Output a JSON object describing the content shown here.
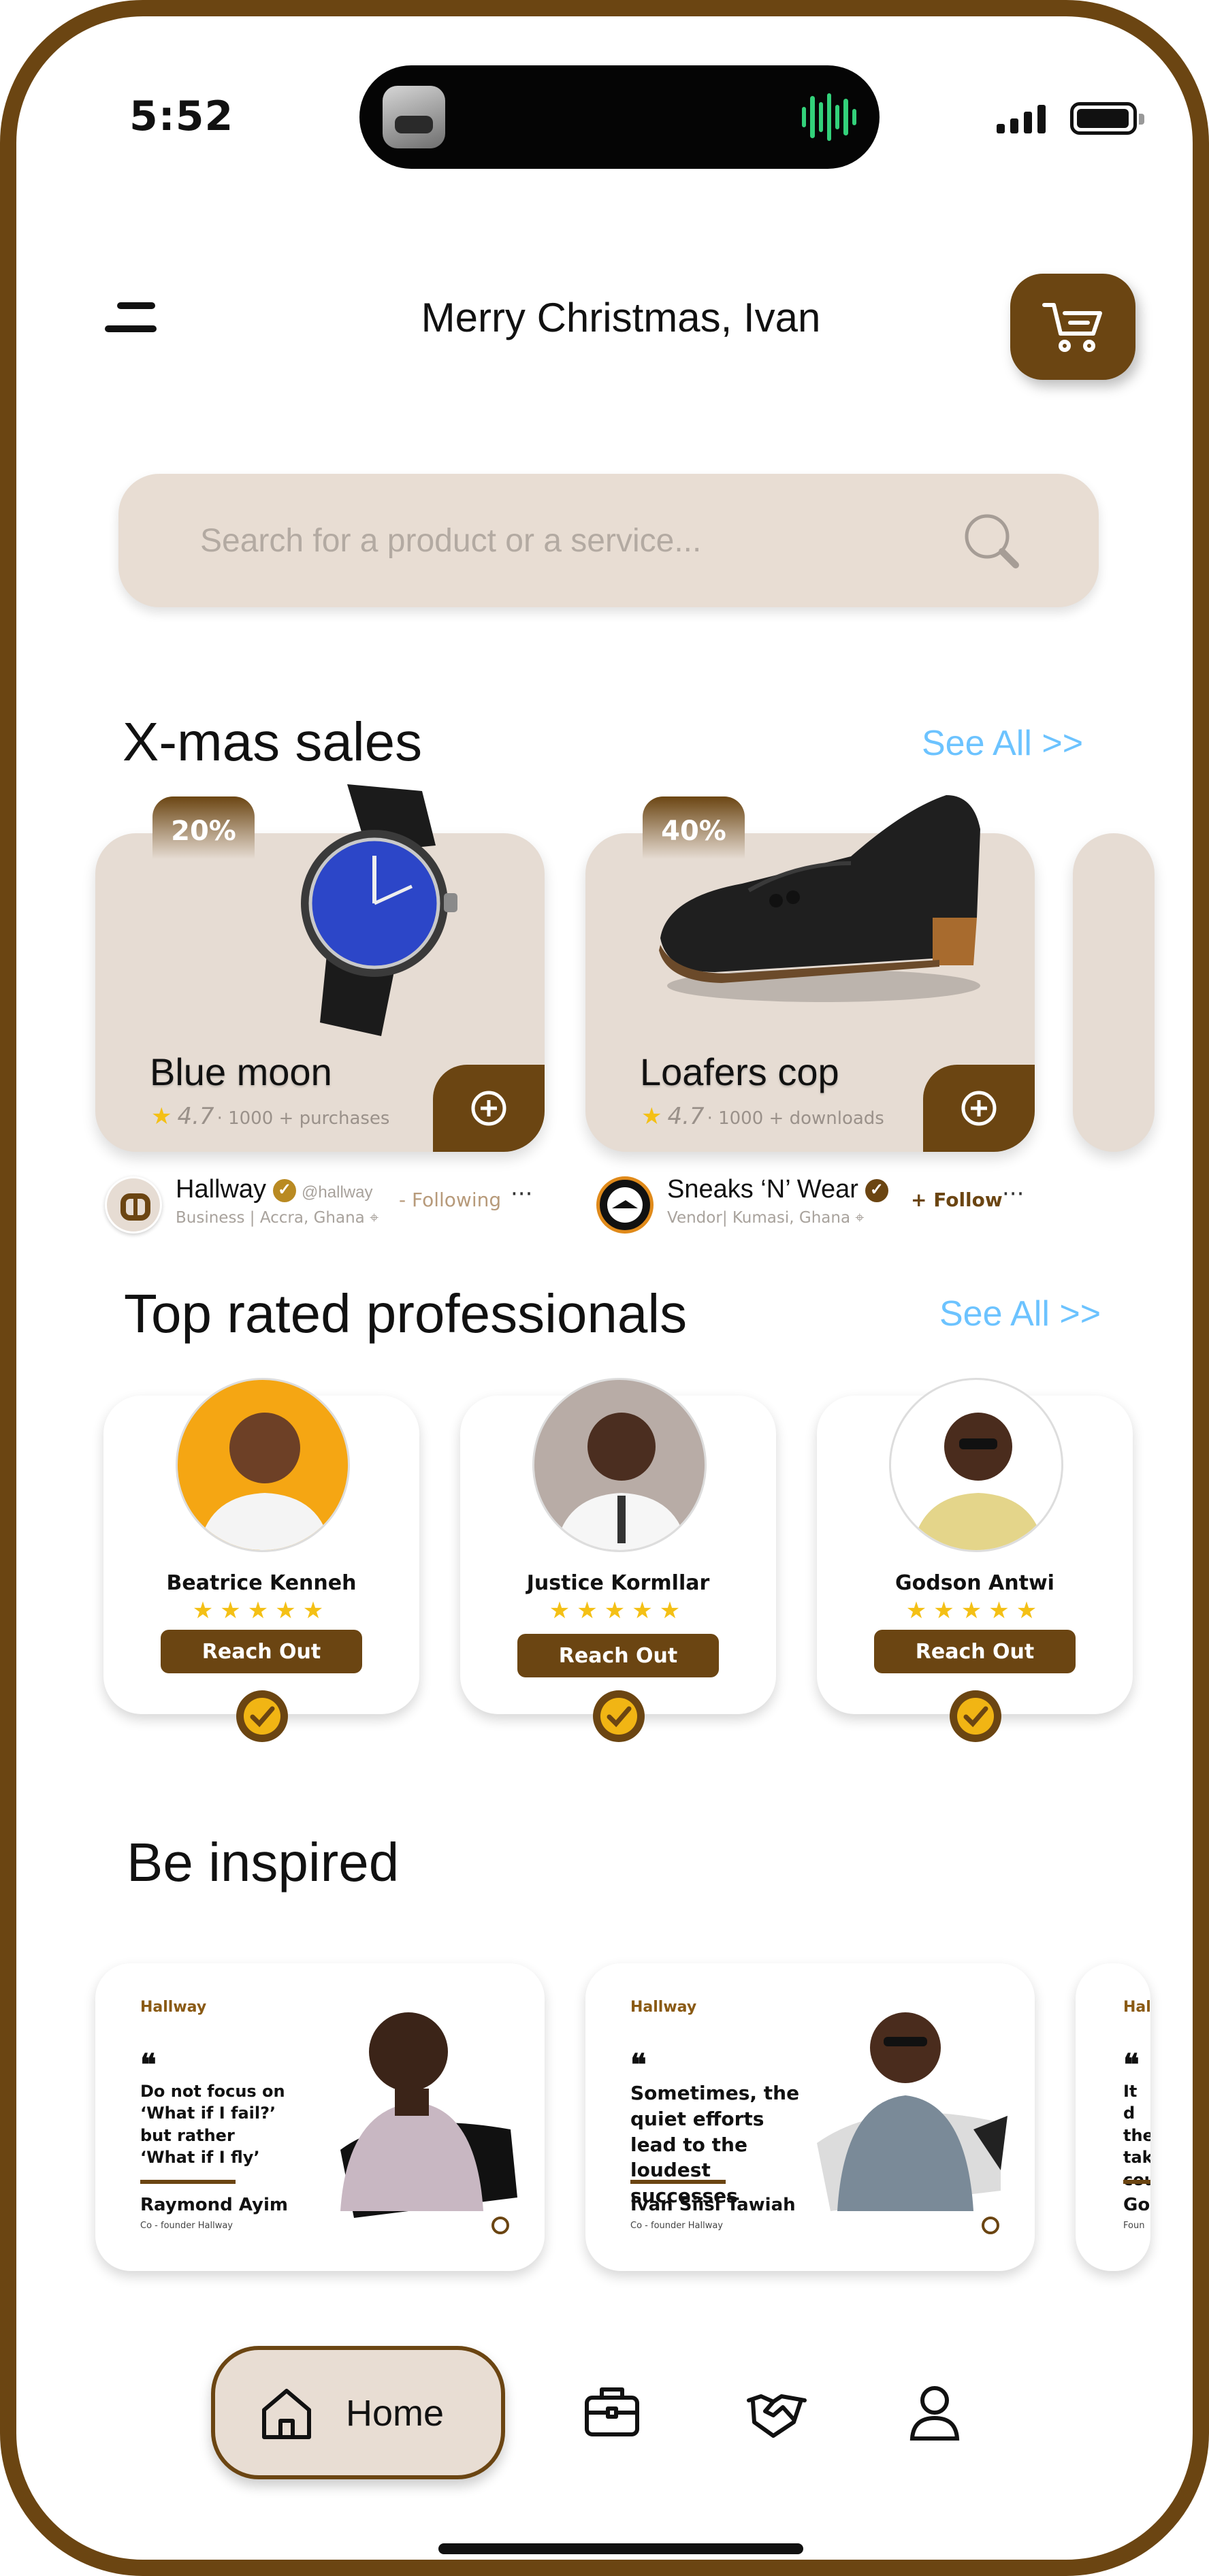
{
  "status_bar": {
    "time": "5:52"
  },
  "header": {
    "greeting": "Merry Christmas, Ivan"
  },
  "search": {
    "placeholder": "Search for a product or a service..."
  },
  "sales_section": {
    "title": "X-mas sales",
    "see_all": "See All >>",
    "products": [
      {
        "discount": "20%",
        "name": "Blue moon",
        "rating": "4.7",
        "stat": "1000 + purchases"
      },
      {
        "discount": "40%",
        "name": "Loafers cop",
        "rating": "4.7",
        "stat": "1000 + downloads"
      }
    ],
    "vendors": [
      {
        "name": "Hallway",
        "handle": "@hallway",
        "type": "Business",
        "location": "Accra, Ghana",
        "action": "- Following",
        "more": "···"
      },
      {
        "name": "Sneaks ‘N’ Wear",
        "type": "Vendor",
        "location": "Kumasi, Ghana",
        "action": "+ Follow",
        "more": "···"
      }
    ]
  },
  "professionals_section": {
    "title": "Top rated professionals",
    "see_all": "See All >>",
    "items": [
      {
        "name": "Beatrice Kenneh",
        "stars": "★★★★★",
        "button": "Reach Out"
      },
      {
        "name": "Justice Kormllar",
        "stars": "★★★★★",
        "button": "Reach Out"
      },
      {
        "name": "Godson Antwi",
        "stars": "★★★★★",
        "button": "Reach Out"
      }
    ]
  },
  "inspire_section": {
    "title": "Be inspired",
    "cards": [
      {
        "brand": "Hallway",
        "quote_mark": "❝",
        "quote": "Do not focus on ‘What if I fail?’ but rather ‘What if I fly’",
        "author": "Raymond Ayim",
        "role": "Co - founder Hallway"
      },
      {
        "brand": "Hallway",
        "quote_mark": "❝",
        "quote": "Sometimes, the quiet efforts lead to the loudest successes",
        "author": "Ivan Siisi Tawiah",
        "role": "Co - founder Hallway"
      },
      {
        "brand": "Hal",
        "quote_mark": "❝",
        "quote": "It d the tak cou",
        "author": "Go",
        "role": "Foun"
      }
    ]
  },
  "bottom_nav": {
    "home_label": "Home"
  },
  "colors": {
    "brand_brown": "#6b4512",
    "card_beige": "#e6dcd3",
    "link_blue": "#6cc3ff",
    "star_gold": "#f4c015"
  },
  "icons": [
    "menu-icon",
    "cart-icon",
    "search-icon",
    "plus-circle-icon",
    "verified-icon",
    "location-pin-icon",
    "home-icon",
    "briefcase-icon",
    "handshake-icon",
    "user-icon"
  ]
}
